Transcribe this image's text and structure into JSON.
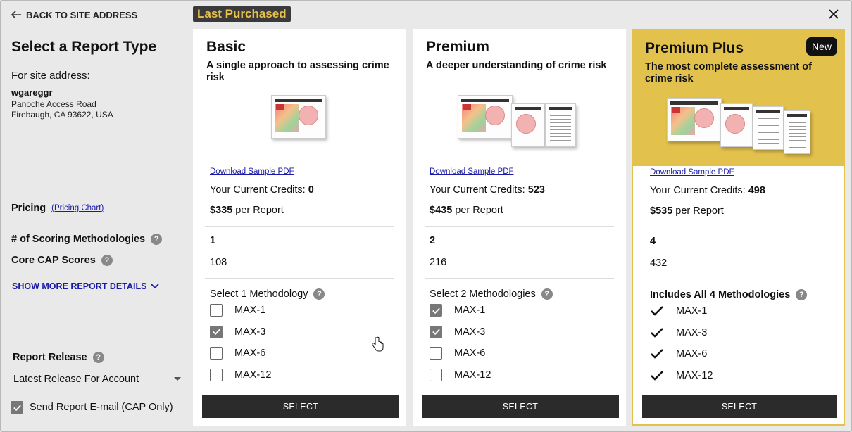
{
  "sidebar": {
    "back_label": "BACK TO SITE ADDRESS",
    "title": "Select a Report Type",
    "site_label": "For site address:",
    "site_name": "wgareggr",
    "address_line1": "Panoche Access Road",
    "address_line2": "Firebaugh, CA 93622, USA",
    "pricing_label": "Pricing",
    "pricing_link": "(Pricing Chart)",
    "methodologies_label": "# of Scoring Methodologies",
    "cap_label": "Core CAP Scores",
    "show_more": "SHOW MORE REPORT DETAILS",
    "release_label": "Report Release",
    "release_value": "Latest Release For Account",
    "email_label": "Send Report E-mail (CAP Only)",
    "email_checked": true,
    "help_glyph": "?"
  },
  "last_purchased": "Last Purchased",
  "cards": [
    {
      "title": "Basic",
      "subtitle": "A single approach to assessing crime risk",
      "download": "Download Sample PDF",
      "credits_label": "Your Current Credits: ",
      "credits_value": "0",
      "price_value": "$335",
      "price_suffix": " per Report",
      "methods_count": "1",
      "cap_scores": "108",
      "method_header": "Select 1 Methodology",
      "options": [
        {
          "label": "MAX-1",
          "checked": false
        },
        {
          "label": "MAX-3",
          "checked": true
        },
        {
          "label": "MAX-6",
          "checked": false
        },
        {
          "label": "MAX-12",
          "checked": false
        }
      ],
      "select_label": "SELECT"
    },
    {
      "title": "Premium",
      "subtitle": "A deeper understanding of crime risk",
      "download": "Download Sample PDF",
      "credits_label": "Your Current Credits: ",
      "credits_value": "523",
      "price_value": "$435",
      "price_suffix": " per Report",
      "methods_count": "2",
      "cap_scores": "216",
      "method_header": "Select 2 Methodologies",
      "options": [
        {
          "label": "MAX-1",
          "checked": true
        },
        {
          "label": "MAX-3",
          "checked": true
        },
        {
          "label": "MAX-6",
          "checked": false
        },
        {
          "label": "MAX-12",
          "checked": false
        }
      ],
      "select_label": "SELECT"
    },
    {
      "title": "Premium Plus",
      "badge": "New",
      "subtitle": "The most complete assessment of crime risk",
      "download": "Download Sample PDF",
      "credits_label": "Your Current Credits: ",
      "credits_value": "498",
      "price_value": "$535",
      "price_suffix": " per Report",
      "methods_count": "4",
      "cap_scores": "432",
      "method_header": "Includes All 4 Methodologies",
      "options": [
        {
          "label": "MAX-1"
        },
        {
          "label": "MAX-3"
        },
        {
          "label": "MAX-6"
        },
        {
          "label": "MAX-12"
        }
      ],
      "select_label": "SELECT"
    }
  ],
  "colors": {
    "accent_gold": "#e3c14d",
    "link_blue": "#1a1aa6",
    "button_dark": "#2b2b2b",
    "badge_text": "#e8c14b"
  }
}
